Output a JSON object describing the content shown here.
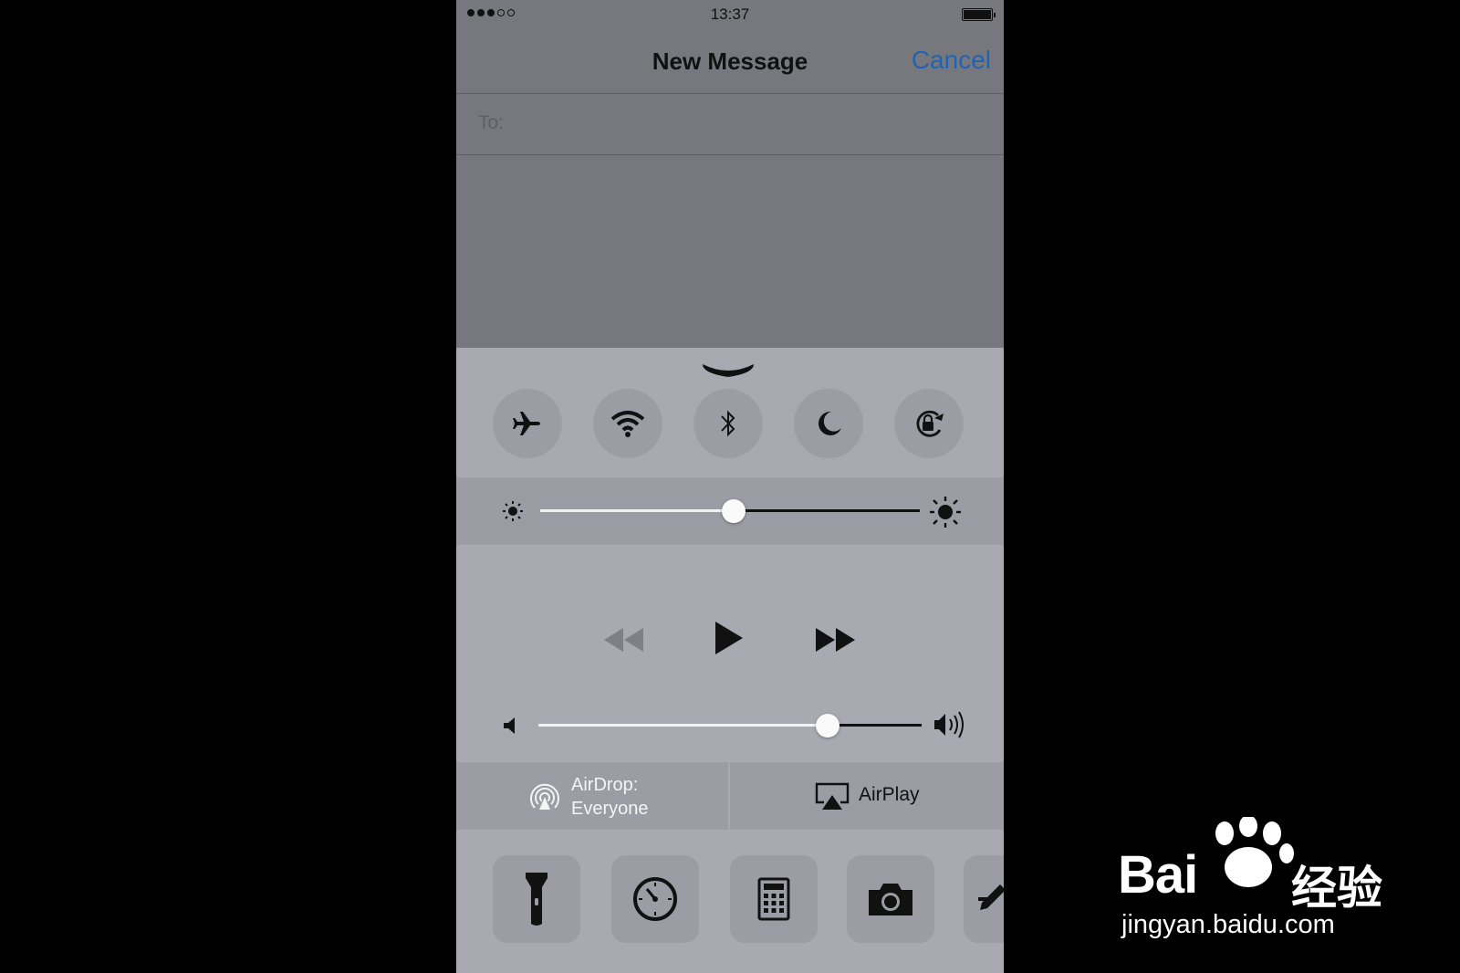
{
  "status_bar": {
    "time": "13:37",
    "signal_bars_on": 3,
    "signal_bars_total": 5
  },
  "nav": {
    "title": "New Message",
    "cancel_label": "Cancel"
  },
  "compose": {
    "to_label": "To:"
  },
  "control_center": {
    "toggles": [
      {
        "icon": "airplane-icon"
      },
      {
        "icon": "wifi-icon"
      },
      {
        "icon": "bluetooth-icon"
      },
      {
        "icon": "moon-icon"
      },
      {
        "icon": "rotation-lock-icon"
      }
    ],
    "brightness_level": 0.51,
    "volume_level": 0.755,
    "media": {
      "controls": [
        "rewind-icon",
        "play-icon",
        "fast-forward-icon"
      ]
    },
    "airdrop": {
      "line1": "AirDrop:",
      "line2": "Everyone"
    },
    "airplay": {
      "label": "AirPlay"
    },
    "shortcuts": [
      "flashlight-icon",
      "timer-icon",
      "calculator-icon",
      "camera-icon",
      "edit-icon"
    ]
  },
  "watermark": {
    "brand": "Bai",
    "brand_cn": "经验",
    "url": "jingyan.baidu.com"
  },
  "colors": {
    "accent": "#1f63b2",
    "panel": "#a9a9b2",
    "button": "#9c9ca5",
    "background": "#77787d"
  }
}
